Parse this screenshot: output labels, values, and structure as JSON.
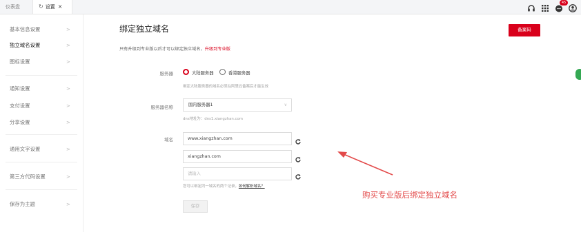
{
  "tabs": {
    "dashboard": "仪表盘",
    "settings": "设置",
    "close": "×"
  },
  "top_icons": {
    "headset": "headset-icon",
    "apps": "apps-grid-icon",
    "messages": "messages-icon",
    "messages_badge": "45",
    "account": "account-icon"
  },
  "sidebar": {
    "items": [
      {
        "label": "基本信息设置",
        "chev": ">"
      },
      {
        "label": "独立域名设置",
        "chev": ">"
      },
      {
        "label": "图标设置",
        "chev": ">"
      },
      {
        "label": "通知设置",
        "chev": ">"
      },
      {
        "label": "支付设置",
        "chev": ">"
      },
      {
        "label": "分享设置",
        "chev": ">"
      },
      {
        "label": "通用文字设置",
        "chev": ">"
      },
      {
        "label": "第三方代码设置",
        "chev": ">"
      },
      {
        "label": "保存为主题",
        "chev": ">"
      }
    ]
  },
  "main": {
    "title": "绑定独立域名",
    "beian_button": "备案码",
    "notice_text": "只有升级到专业版以后才可以绑定独立域名，",
    "notice_link": "升级到专业版",
    "server_label": "服务器",
    "server_options": [
      "大陆服务器",
      "香港服务器"
    ],
    "server_hint": "绑定大陆服务器的域名必须在阿里云备案后才能生效",
    "server_name_label": "服务器名称",
    "server_name_value": "国内服务器1",
    "dns_hint": "dns地址为：dns1.xiangzhan.com",
    "domain_label": "域名",
    "domains": [
      "www.xiangzhan.com",
      "xiangzhan.com"
    ],
    "domain_placeholder": "请输入",
    "domain_hint": "您可以绑定同一域名的两个记录，",
    "domain_hint_link": "如何解析域名？",
    "save_button": "保存"
  },
  "annotation": {
    "text": "购买专业版后绑定独立域名"
  },
  "colors": {
    "accent": "#d9001b",
    "annotation": "#e34a4a"
  }
}
